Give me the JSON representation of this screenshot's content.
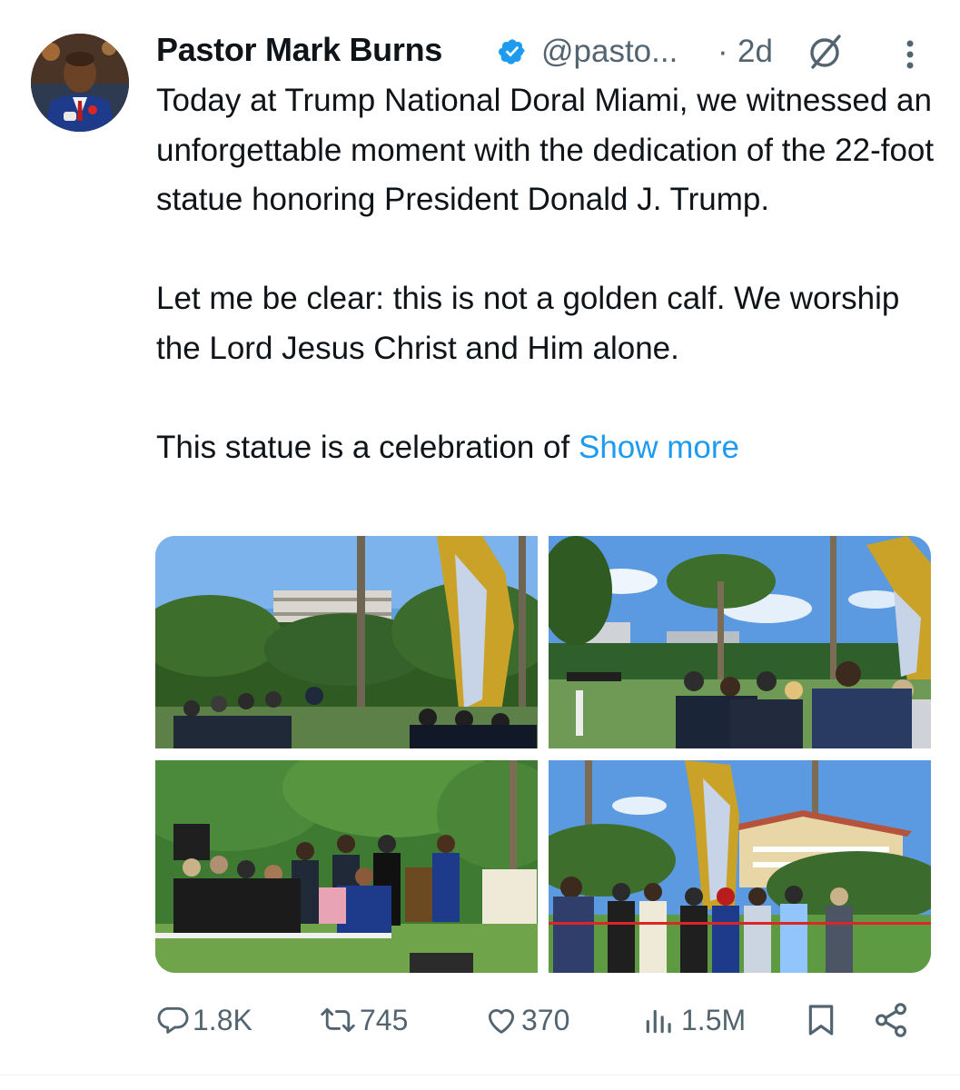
{
  "post": {
    "author_name": "Pastor Mark Burns",
    "handle": "@pasto...",
    "separator": "·",
    "time_ago": "2d",
    "text_lines": [
      "Today at Trump National Doral Miami, we witnessed an unforgettable moment with the dedication of the 22-foot statue honoring President Donald J. Trump.",
      "Let me be clear: this is not a golden calf. We worship the Lord Jesus Christ and Him alone."
    ],
    "truncated_text": "This statue is a celebration of ",
    "show_more_label": "Show more"
  },
  "icons": {
    "verified": "verified-badge-icon",
    "grok": "grok-icon",
    "more": "more-vertical-icon",
    "reply": "reply-icon",
    "repost": "repost-icon",
    "like": "like-icon",
    "views": "views-icon",
    "bookmark": "bookmark-icon",
    "share": "share-icon"
  },
  "actions": {
    "replies": "1.8K",
    "reposts": "745",
    "likes": "370",
    "views": "1.5M"
  },
  "colors": {
    "text": "#0f1419",
    "secondary": "#536471",
    "accent": "#1d9bf0",
    "statue_gold": "#c9a227"
  }
}
